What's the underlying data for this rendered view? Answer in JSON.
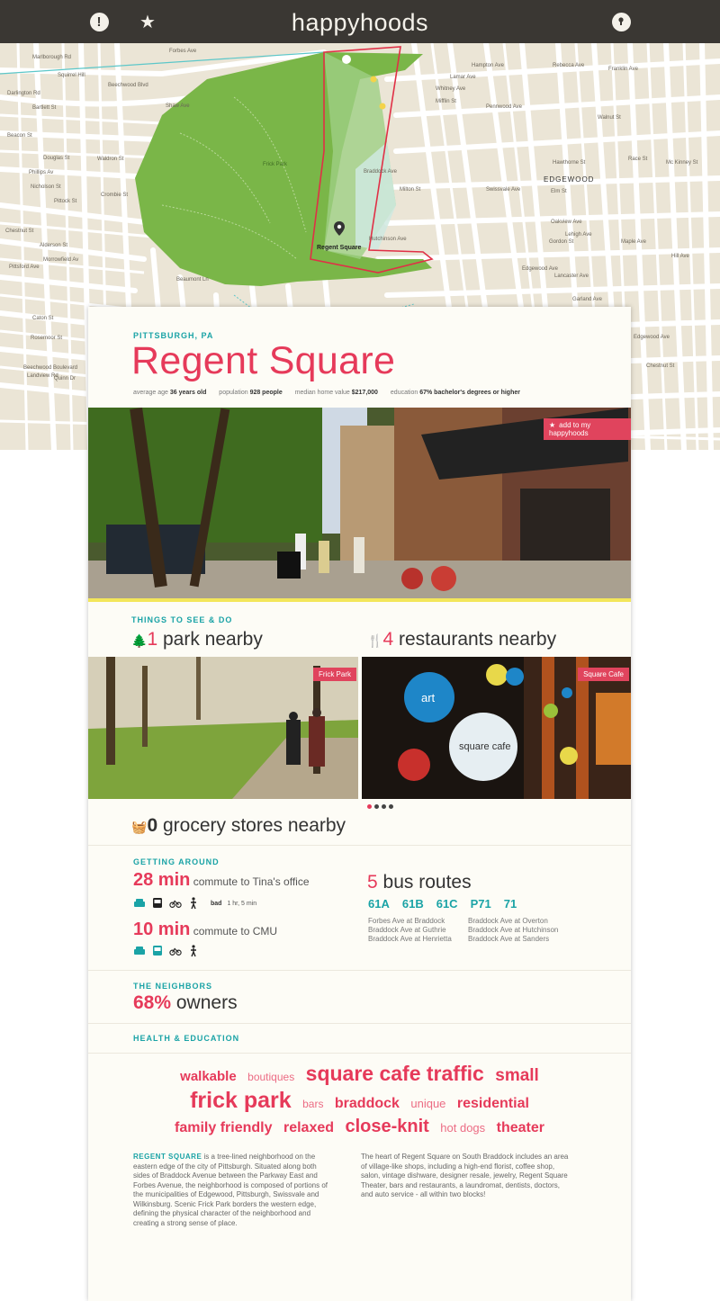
{
  "app": {
    "logo": "happyhoods"
  },
  "map": {
    "labels": [
      "Marlborough Rd",
      "Forbes Ave",
      "Squirrel Hill",
      "Beechwood Blvd",
      "Darlington Rd",
      "Bartlett St",
      "Beacon St",
      "Douglas St",
      "Phillips Av",
      "Nicholson St",
      "Waldron St",
      "Crombie St",
      "Pittock St",
      "Alderson St",
      "Morrowfield Av",
      "Chestnut St",
      "Pittsford Ave",
      "Shaw Ave",
      "Frick Park",
      "Regent Square",
      "Braddock Ave",
      "Hutchinson Ave",
      "Milton St",
      "Mifflin St",
      "Pennwood Ave",
      "Hawthorne St",
      "Swissvale Ave",
      "EDGEWOOD",
      "Edgewood Ave",
      "Mc Kinney St",
      "Hill Ave",
      "Lancaster Ave",
      "Garland Ave",
      "Walnut St",
      "Race St",
      "Hampton Ave",
      "Franklin Ave",
      "Rebecca Ave",
      "Whitney Ave",
      "Lamar Ave",
      "Gordon St",
      "Elm St",
      "Oakview Ave",
      "Lehigh Ave",
      "Maple Ave",
      "Beaumont Ln",
      "Landview Rd",
      "Rosemoor St",
      "Caton St",
      "Quinn Dr",
      "Beechwood Boulevard",
      "Edgewood Ave",
      "Chestnut St"
    ]
  },
  "card": {
    "location": "PITTSBURGH, PA",
    "title": "Regent Square",
    "stats": [
      {
        "label": "average age",
        "value": "36 years old"
      },
      {
        "label": "population",
        "value": "928 people"
      },
      {
        "label": "median home value",
        "value": "$217,000"
      },
      {
        "label": "education",
        "value": "67% bachelor's degrees or higher"
      }
    ],
    "add_button": "add to my happyhoods",
    "things": {
      "heading": "THINGS TO SEE & DO",
      "parks_count": "1",
      "parks_label": "park nearby",
      "restaurants_count": "4",
      "restaurants_label": "restaurants nearby",
      "park_photo_tag": "Frick Park",
      "restaurant_photo_tag": "Square Cafe",
      "cafe_sign_1": "art",
      "cafe_sign_2": "square cafe",
      "grocery_count": "0",
      "grocery_label": "grocery stores nearby"
    },
    "getting_around": {
      "heading": "GETTING AROUND",
      "commute1_value": "28 min",
      "commute1_label": "commute to Tina's office",
      "commute1_bad": "bad",
      "commute1_bad_time": "1 hr, 5 min",
      "commute2_value": "10 min",
      "commute2_label": "commute to CMU",
      "bus_count": "5",
      "bus_label": "bus routes",
      "routes": [
        "61A",
        "61B",
        "61C",
        "P71",
        "71"
      ],
      "stops_left": [
        "Forbes Ave at Braddock",
        "Braddock Ave at Guthrie",
        "Braddock Ave at Henrietta"
      ],
      "stops_right": [
        "Braddock Ave at Overton",
        "Braddock Ave at Hutchinson",
        "Braddock Ave at Sanders"
      ]
    },
    "neighbors": {
      "heading": "THE NEIGHBORS",
      "owners_value": "68%",
      "owners_label": "owners"
    },
    "health": {
      "heading": "HEALTH & EDUCATION",
      "cloud": [
        [
          "walkable",
          "boutiques",
          "square cafe traffic",
          "small"
        ],
        [
          "frick park",
          "bars",
          "braddock",
          "unique",
          "residential"
        ],
        [
          "family friendly",
          "relaxed",
          "close-knit",
          "hot dogs",
          "theater"
        ]
      ],
      "desc_lead": "REGENT SQUARE",
      "desc_left": "is a tree-lined neighborhood on the eastern edge of the city of Pittsburgh. Situated along both sides of Braddock Avenue between the Parkway East and Forbes Avenue, the neighborhood is composed of portions of the municipalities of Edgewood, Pittsburgh, Swissvale and Wilkinsburg. Scenic Frick Park borders the western edge, defining the physical character of the neighborhood and creating a strong sense of place.",
      "desc_right": "The heart of Regent Square on South Braddock includes an area of village-like shops, including a high-end florist, coffee shop, salon, vintage dishware, designer resale, jewelry, Regent Square Theater, bars and restaurants, a laundromat, dentists, doctors, and auto service - all within two blocks!"
    }
  },
  "colors": {
    "accent": "#e63a5a",
    "teal": "#1aa3a6",
    "topbar": "#3a3733",
    "park_green": "#7ab648",
    "map_bg": "#ebe5d6"
  }
}
